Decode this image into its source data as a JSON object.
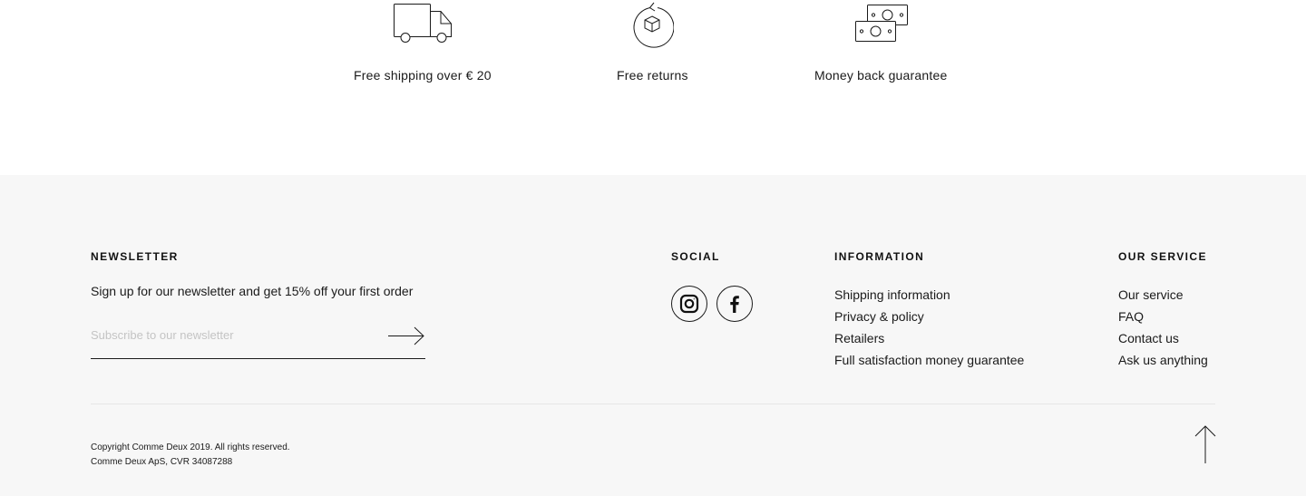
{
  "usp": {
    "items": [
      {
        "icon": "truck-icon",
        "label": "Free shipping over € 20"
      },
      {
        "icon": "returns-icon",
        "label": "Free returns"
      },
      {
        "icon": "money-icon",
        "label": "Money back guarantee"
      }
    ]
  },
  "footer": {
    "newsletter": {
      "heading": "NEWSLETTER",
      "text": "Sign up for our newsletter and get 15% off your first order",
      "placeholder": "Subscribe to our newsletter",
      "submit_icon": "arrow-right-icon"
    },
    "social": {
      "heading": "SOCIAL",
      "links": [
        {
          "icon": "instagram-icon"
        },
        {
          "icon": "facebook-icon"
        }
      ]
    },
    "information": {
      "heading": "INFORMATION",
      "links": [
        "Shipping information",
        "Privacy & policy",
        "Retailers",
        "Full satisfaction money guarantee"
      ]
    },
    "service": {
      "heading": "OUR SERVICE",
      "links": [
        "Our service",
        "FAQ",
        "Contact us",
        "Ask us anything"
      ]
    },
    "legal": {
      "copyright": "Copyright Comme Deux 2019. All rights reserved.",
      "company": "Comme Deux ApS, CVR 34087288"
    },
    "back_to_top_icon": "arrow-up-icon"
  }
}
